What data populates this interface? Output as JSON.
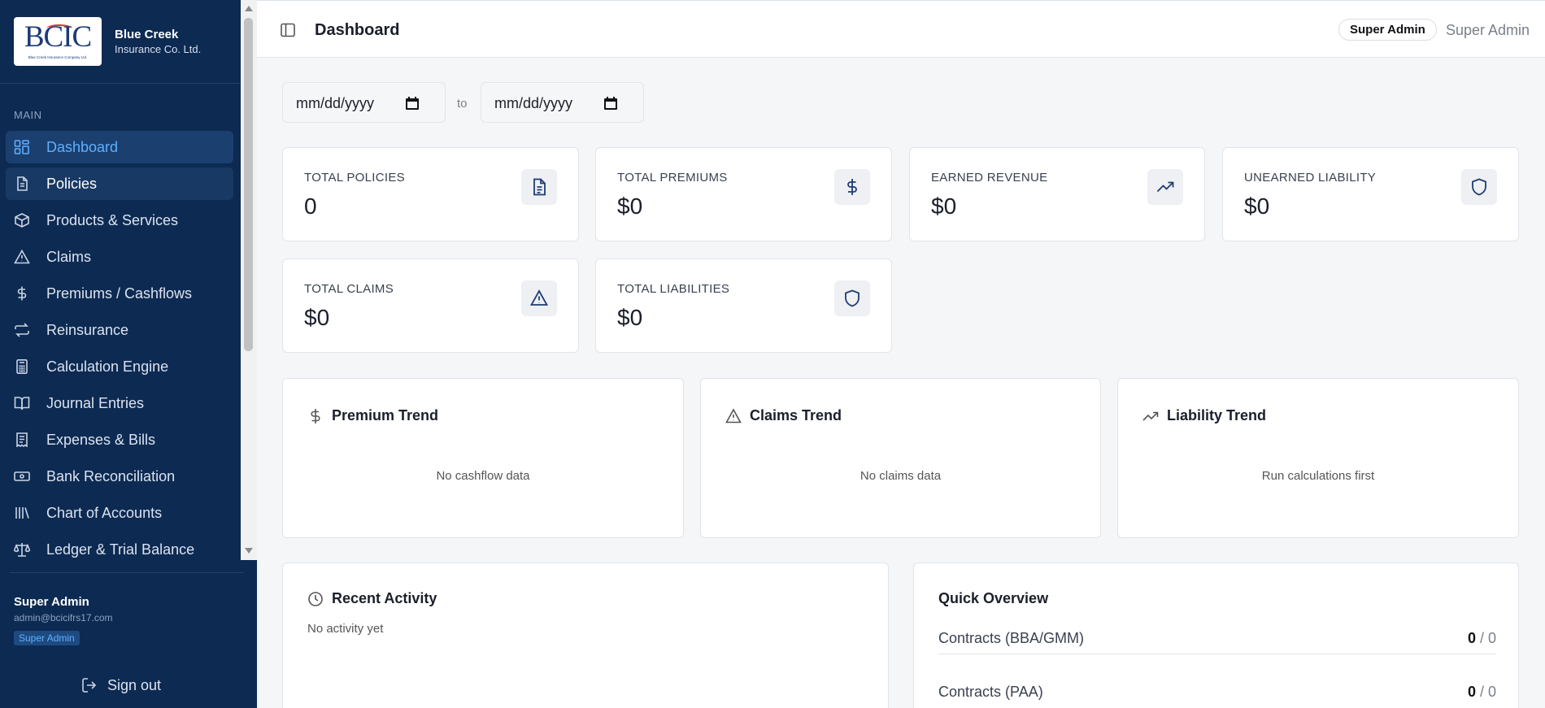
{
  "brand": {
    "logo_text": "BCIC",
    "logo_caption": "Blue Creek Insurance Company Ltd.",
    "name": "Blue Creek",
    "subtitle": "Insurance Co. Ltd."
  },
  "sidebar": {
    "section": "MAIN",
    "items": [
      {
        "label": "Dashboard",
        "icon": "dashboard-icon"
      },
      {
        "label": "Policies",
        "icon": "document-icon"
      },
      {
        "label": "Products & Services",
        "icon": "box-icon"
      },
      {
        "label": "Claims",
        "icon": "warning-icon"
      },
      {
        "label": "Premiums / Cashflows",
        "icon": "dollar-icon"
      },
      {
        "label": "Reinsurance",
        "icon": "repeat-icon"
      },
      {
        "label": "Calculation Engine",
        "icon": "calculator-icon"
      },
      {
        "label": "Journal Entries",
        "icon": "book-icon"
      },
      {
        "label": "Expenses & Bills",
        "icon": "receipt-icon"
      },
      {
        "label": "Bank Reconciliation",
        "icon": "banknote-icon"
      },
      {
        "label": "Chart of Accounts",
        "icon": "library-icon"
      },
      {
        "label": "Ledger & Trial Balance",
        "icon": "scale-icon"
      }
    ],
    "user": {
      "name": "Super Admin",
      "email": "admin@bcicifrs17.com",
      "role": "Super Admin"
    },
    "signout_label": "Sign out"
  },
  "header": {
    "title": "Dashboard",
    "role_pill": "Super Admin",
    "user_name": "Super Admin"
  },
  "filters": {
    "from_placeholder": "mm/dd/yyyy",
    "to_label": "to",
    "to_placeholder": "mm/dd/yyyy"
  },
  "stats": [
    {
      "label": "TOTAL POLICIES",
      "value": "0",
      "icon": "document-icon"
    },
    {
      "label": "TOTAL PREMIUMS",
      "value": "$0",
      "icon": "dollar-icon"
    },
    {
      "label": "EARNED REVENUE",
      "value": "$0",
      "icon": "trending-up-icon"
    },
    {
      "label": "UNEARNED LIABILITY",
      "value": "$0",
      "icon": "shield-icon"
    },
    {
      "label": "TOTAL CLAIMS",
      "value": "$0",
      "icon": "warning-icon"
    },
    {
      "label": "TOTAL LIABILITIES",
      "value": "$0",
      "icon": "shield-icon"
    }
  ],
  "trends": [
    {
      "title": "Premium Trend",
      "empty": "No cashflow data",
      "icon": "dollar-icon"
    },
    {
      "title": "Claims Trend",
      "empty": "No claims data",
      "icon": "warning-icon"
    },
    {
      "title": "Liability Trend",
      "empty": "Run calculations first",
      "icon": "trending-up-icon"
    }
  ],
  "activity": {
    "title": "Recent Activity",
    "empty": "No activity yet"
  },
  "overview": {
    "title": "Quick Overview",
    "rows": [
      {
        "label": "Contracts (BBA/GMM)",
        "value": "0",
        "total": " / 0"
      },
      {
        "label": "Contracts (PAA)",
        "value": "0",
        "total": " / 0"
      }
    ]
  },
  "colors": {
    "sidebar_bg": "#0d2a52",
    "accent": "#5fb0ff",
    "icon_navy": "#1e3d73"
  }
}
